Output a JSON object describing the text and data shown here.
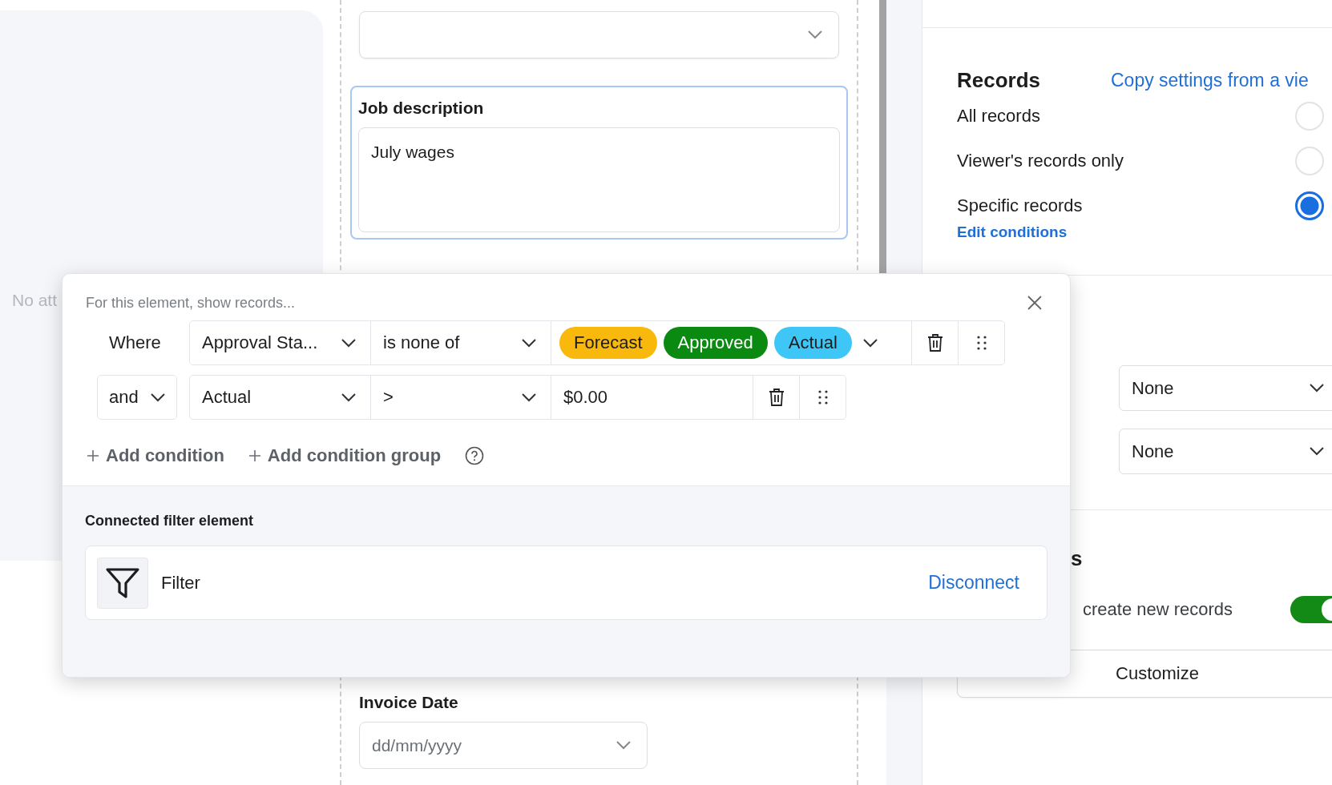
{
  "left_panel": {
    "empty_text": "No att"
  },
  "form": {
    "fields": [
      {
        "kind": "select",
        "selected": false
      },
      {
        "kind": "textarea",
        "label": "Job description",
        "value": "July wages",
        "selected": true
      },
      {
        "kind": "date",
        "label": "Invoice Date",
        "placeholder": "dd/mm/yyyy",
        "selected": false
      }
    ]
  },
  "settings": {
    "records": {
      "title": "Records",
      "copy_link": "Copy settings from a vie",
      "options": [
        {
          "label": "All records",
          "selected": false
        },
        {
          "label": "Viewer's records only",
          "selected": false
        },
        {
          "label": "Specific records",
          "selected": true
        }
      ],
      "edit_link": "Edit conditions"
    },
    "selects": [
      {
        "value": "None"
      },
      {
        "value": "None"
      }
    ],
    "section_title": "s",
    "toggle": {
      "label": "create new records",
      "on": true
    },
    "customize_button": "Customize"
  },
  "filter_popup": {
    "hint": "For this element, show records...",
    "conditions": [
      {
        "kind": "tags",
        "conjunction": {
          "kind": "label",
          "text": "Where"
        },
        "field": "Approval Sta...",
        "operator": "is none of",
        "tags": [
          {
            "label": "Forecast",
            "color": "#f9b80c"
          },
          {
            "label": "Approved",
            "color": "#0b8a12"
          },
          {
            "label": "Actual",
            "color": "#3ec7f6"
          }
        ]
      },
      {
        "kind": "text",
        "conjunction": {
          "kind": "select",
          "text": "and"
        },
        "field": "Actual",
        "operator": ">",
        "value": "$0.00"
      }
    ],
    "add_buttons": [
      "Add condition",
      "Add condition group"
    ],
    "connected": {
      "title": "Connected filter element",
      "element": "Filter",
      "action": "Disconnect"
    }
  }
}
